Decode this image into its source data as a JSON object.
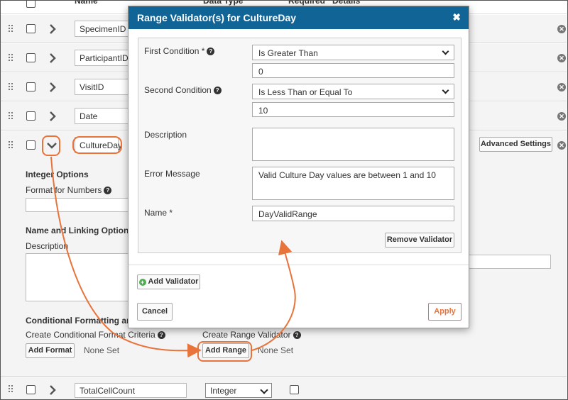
{
  "header": {
    "col_name": "Name",
    "col_data_type": "Data Type",
    "col_required": "Required",
    "col_details": "Details"
  },
  "fields": [
    {
      "name": "SpecimenID"
    },
    {
      "name": "ParticipantID"
    },
    {
      "name": "VisitID"
    },
    {
      "name": "Date"
    },
    {
      "name": "CultureDay"
    },
    {
      "name": "TotalCellCount",
      "data_type": "Integer"
    }
  ],
  "expanded": {
    "advanced_settings_label": "Advanced Settings",
    "integer_options_title": "Integer Options",
    "format_for_numbers_label": "Format for Numbers",
    "name_linking_title": "Name and Linking Options",
    "description_label": "Description",
    "conditional_title": "Conditional Formatting and Validation Options",
    "create_conditional_label": "Create Conditional Format Criteria",
    "create_range_label": "Create Range Validator",
    "add_format_label": "Add Format",
    "add_range_label": "Add Range",
    "none_set_1": "None Set",
    "none_set_2": "None Set"
  },
  "modal": {
    "title": "Range Validator(s) for CultureDay",
    "close_symbol": "✖",
    "first_condition_label": "First Condition *",
    "first_condition_value": "Is Greater Than",
    "first_condition_input": "0",
    "second_condition_label": "Second Condition",
    "second_condition_value": "Is Less Than or Equal To",
    "second_condition_input": "10",
    "description_label": "Description",
    "description_value": "",
    "error_message_label": "Error Message",
    "error_message_value": "Valid Culture Day values are between 1 and 10",
    "name_label": "Name *",
    "name_value": "DayValidRange",
    "remove_validator_label": "Remove Validator",
    "add_validator_label": "Add Validator",
    "cancel_label": "Cancel",
    "apply_label": "Apply"
  },
  "colors": {
    "header_blue": "#116596",
    "callout_orange": "#e8733b",
    "apply_orange": "#e8733b"
  },
  "icons": [
    "drag-handle-icon",
    "chevron-right-icon",
    "chevron-down-icon",
    "remove-circle-icon",
    "help-icon",
    "add-circle-icon",
    "close-icon",
    "dropdown-arrow-icon"
  ]
}
